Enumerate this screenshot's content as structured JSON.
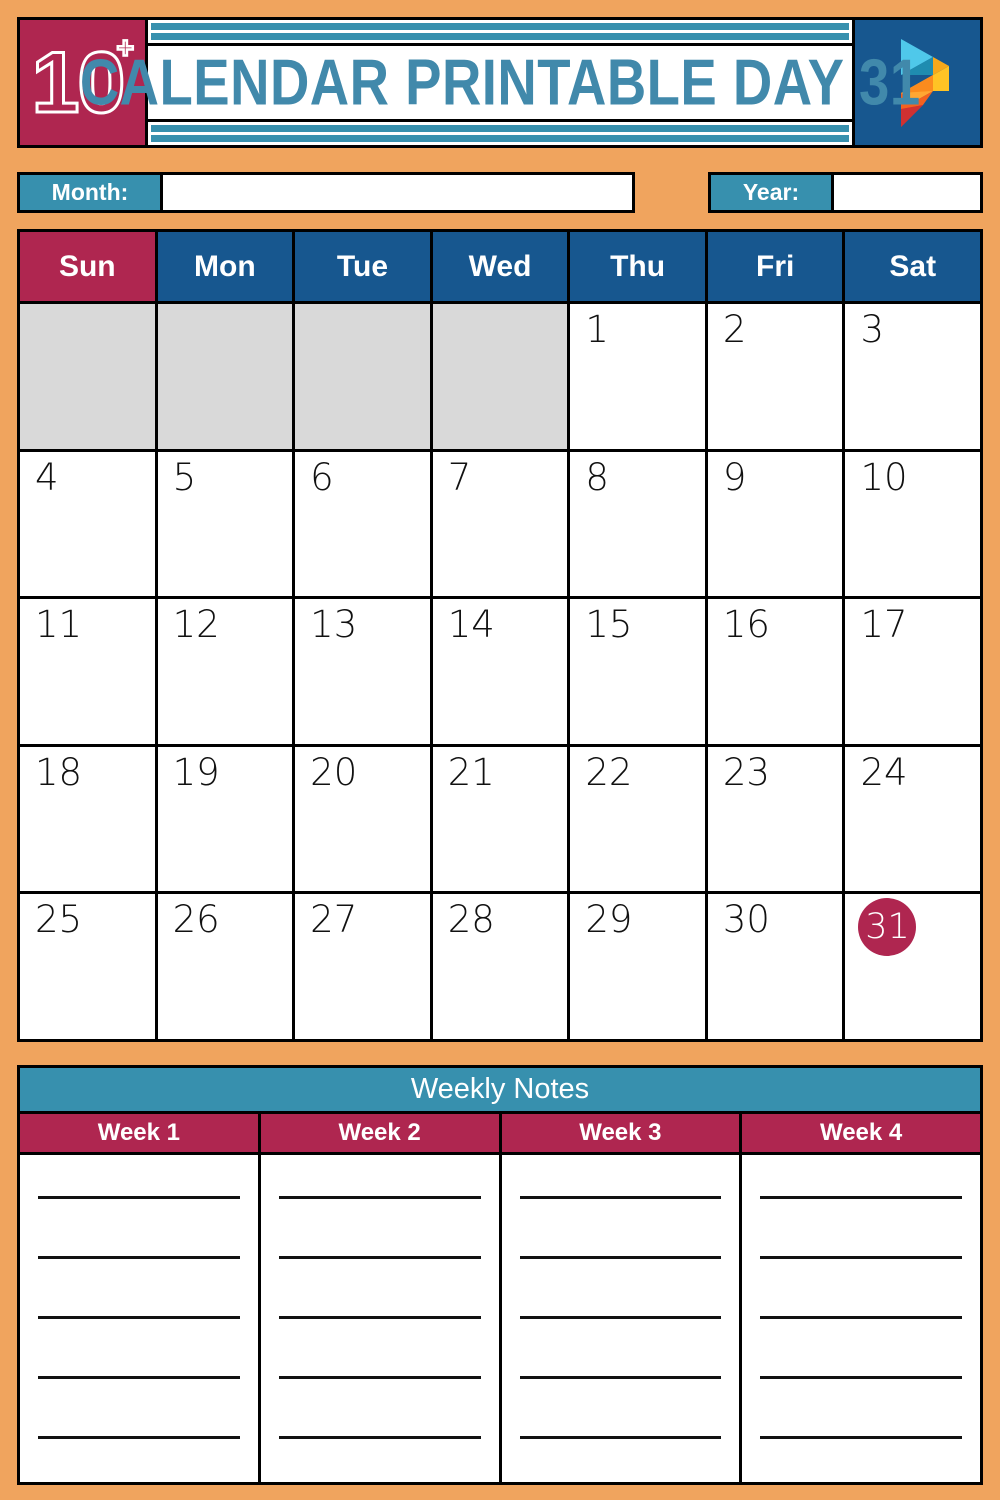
{
  "header": {
    "badge_count": "10",
    "badge_plus": "+",
    "title": "CALENDAR PRINTABLE DAY 31",
    "logo_name": "printablee-logo"
  },
  "fields": {
    "month_label": "Month:",
    "month_value": "",
    "year_label": "Year:",
    "year_value": ""
  },
  "calendar": {
    "weekdays": [
      "Sun",
      "Mon",
      "Tue",
      "Wed",
      "Thu",
      "Fri",
      "Sat"
    ],
    "weeks": [
      [
        "",
        "",
        "",
        "",
        "1",
        "2",
        "3"
      ],
      [
        "4",
        "5",
        "6",
        "7",
        "8",
        "9",
        "10"
      ],
      [
        "11",
        "12",
        "13",
        "14",
        "15",
        "16",
        "17"
      ],
      [
        "18",
        "19",
        "20",
        "21",
        "22",
        "23",
        "24"
      ],
      [
        "25",
        "26",
        "27",
        "28",
        "29",
        "30",
        "31"
      ]
    ],
    "highlighted_day": "31"
  },
  "notes": {
    "title": "Weekly Notes",
    "weeks": [
      "Week 1",
      "Week 2",
      "Week 3",
      "Week 4"
    ],
    "lines_per_week": 5
  },
  "colors": {
    "page_background": "#f0a45e",
    "maroon": "#af2650",
    "dark_blue": "#17578f",
    "teal": "#3790ae",
    "title_teal": "#4189ab",
    "blank_cell_grey": "#d9d9d9",
    "ink": "#000000",
    "paper": "#ffffff"
  }
}
